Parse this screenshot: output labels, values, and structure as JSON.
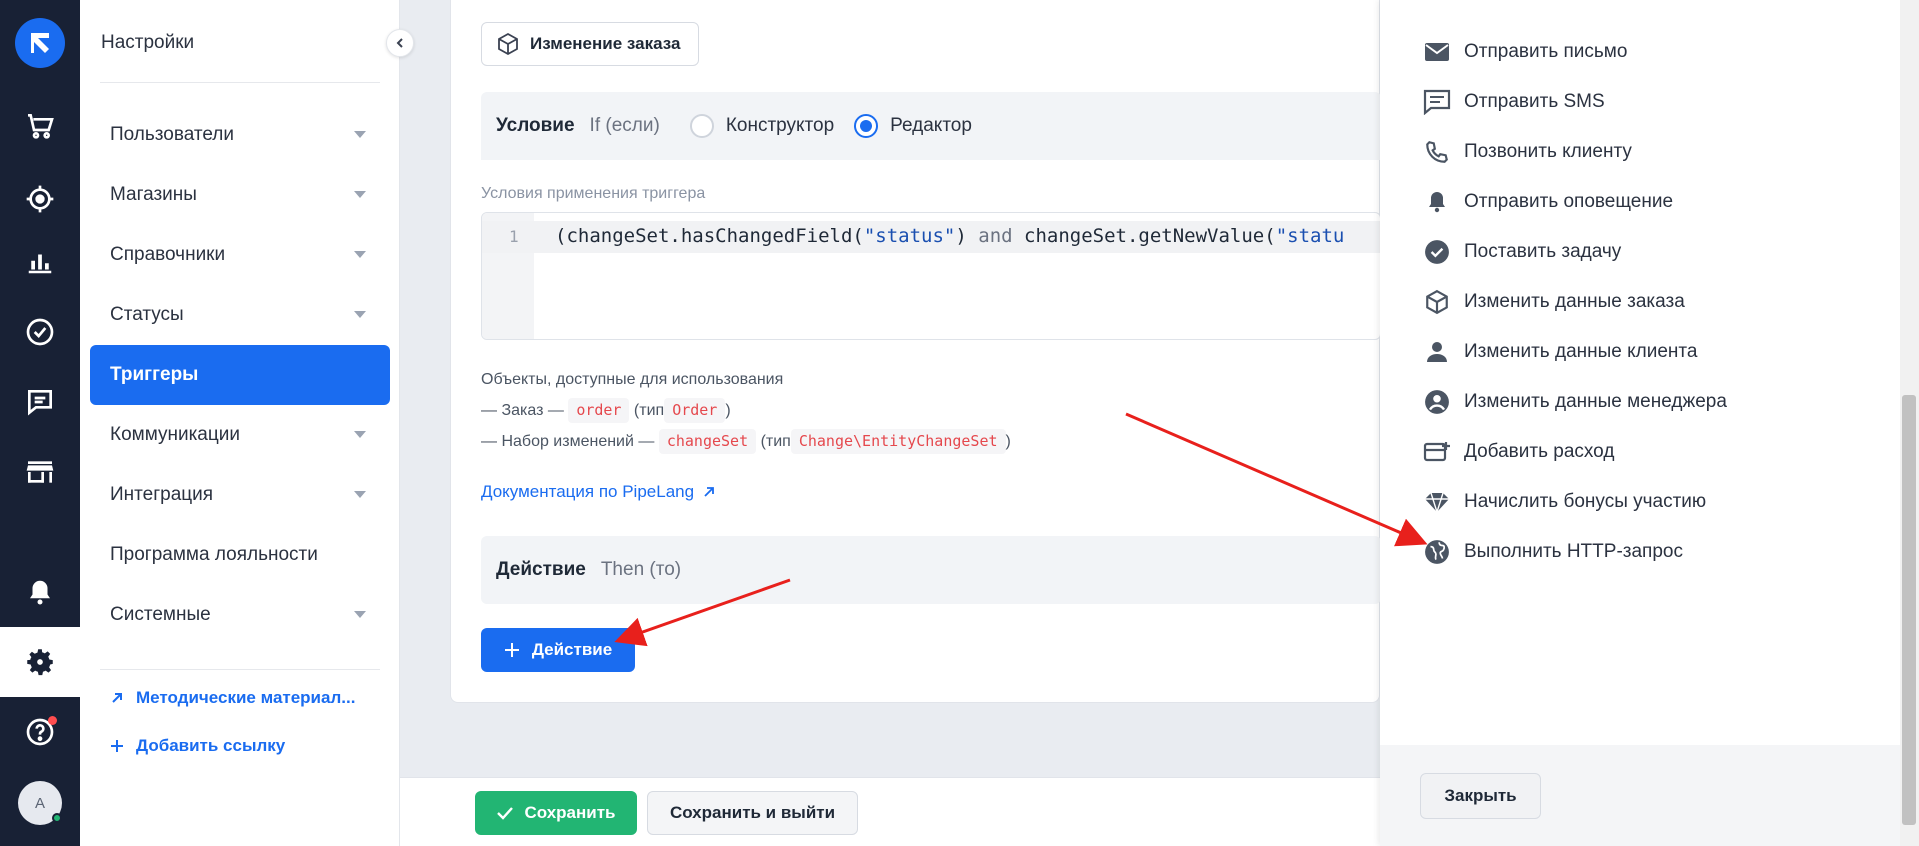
{
  "rail": {
    "icons": [
      "logo-icon",
      "cart-icon",
      "crosshair-icon",
      "bar-chart-icon",
      "check-circle-icon",
      "chat-icon",
      "store-icon",
      "bell-icon",
      "gear-icon",
      "help-icon"
    ],
    "avatar_letter": "A"
  },
  "sidebar": {
    "title": "Настройки",
    "items": [
      {
        "label": "Пользователи"
      },
      {
        "label": "Магазины"
      },
      {
        "label": "Справочники"
      },
      {
        "label": "Статусы"
      },
      {
        "label": "Триггеры"
      },
      {
        "label": "Коммуникации"
      },
      {
        "label": "Интеграция"
      },
      {
        "label": "Программа лояльности"
      },
      {
        "label": "Системные"
      }
    ],
    "links": [
      {
        "label": "Методические материал..."
      },
      {
        "label": "Добавить ссылку"
      }
    ]
  },
  "main": {
    "chip_label": "Изменение заказа",
    "condition": {
      "title": "Условие",
      "subtitle": "If (если)",
      "options": [
        "Конструктор",
        "Редактор"
      ],
      "selected": "Редактор"
    },
    "editor_label": "Условия применения триггера",
    "editor": {
      "line_number": "1",
      "code_parts": [
        "(changeSet.hasChangedField(",
        "\"status\"",
        ") ",
        "and",
        " changeSet.getNewValue(",
        "\"statu"
      ]
    },
    "objects": {
      "heading": "Объекты, доступные для использования",
      "row1_prefix": "— Заказ —",
      "row1_token": "order",
      "row1_type_prefix": "(тип",
      "row1_type": "Order",
      "row1_suffix": ")",
      "row2_prefix": "— Набор изменений —",
      "row2_token": "changeSet",
      "row2_type_prefix": "(тип",
      "row2_type": "Change\\EntityChangeSet",
      "row2_suffix": ")"
    },
    "doc_link": "Документация по PipeLang",
    "action": {
      "title": "Действие",
      "subtitle": "Then (то)",
      "button_label": "Действие"
    }
  },
  "footer": {
    "save_label": "Сохранить",
    "save_exit_label": "Сохранить и выйти"
  },
  "drawer": {
    "items": [
      {
        "label": "Отправить письмо",
        "icon": "mail-icon"
      },
      {
        "label": "Отправить SMS",
        "icon": "sms-icon"
      },
      {
        "label": "Позвонить клиенту",
        "icon": "phone-icon"
      },
      {
        "label": "Отправить оповещение",
        "icon": "bell-icon"
      },
      {
        "label": "Поставить задачу",
        "icon": "check-circle-icon"
      },
      {
        "label": "Изменить данные заказа",
        "icon": "box-icon"
      },
      {
        "label": "Изменить данные клиента",
        "icon": "person-icon"
      },
      {
        "label": "Изменить данные менеджера",
        "icon": "account-circle-icon"
      },
      {
        "label": "Добавить расход",
        "icon": "expense-icon"
      },
      {
        "label": "Начислить бонусы участию",
        "icon": "gem-icon"
      },
      {
        "label": "Выполнить HTTP-запрос",
        "icon": "globe-icon"
      }
    ],
    "close_label": "Закрыть"
  },
  "colors": {
    "accent": "#1a6cf0",
    "rail": "#182135",
    "success": "#22b573",
    "annotation_arrow": "#e8201c"
  }
}
